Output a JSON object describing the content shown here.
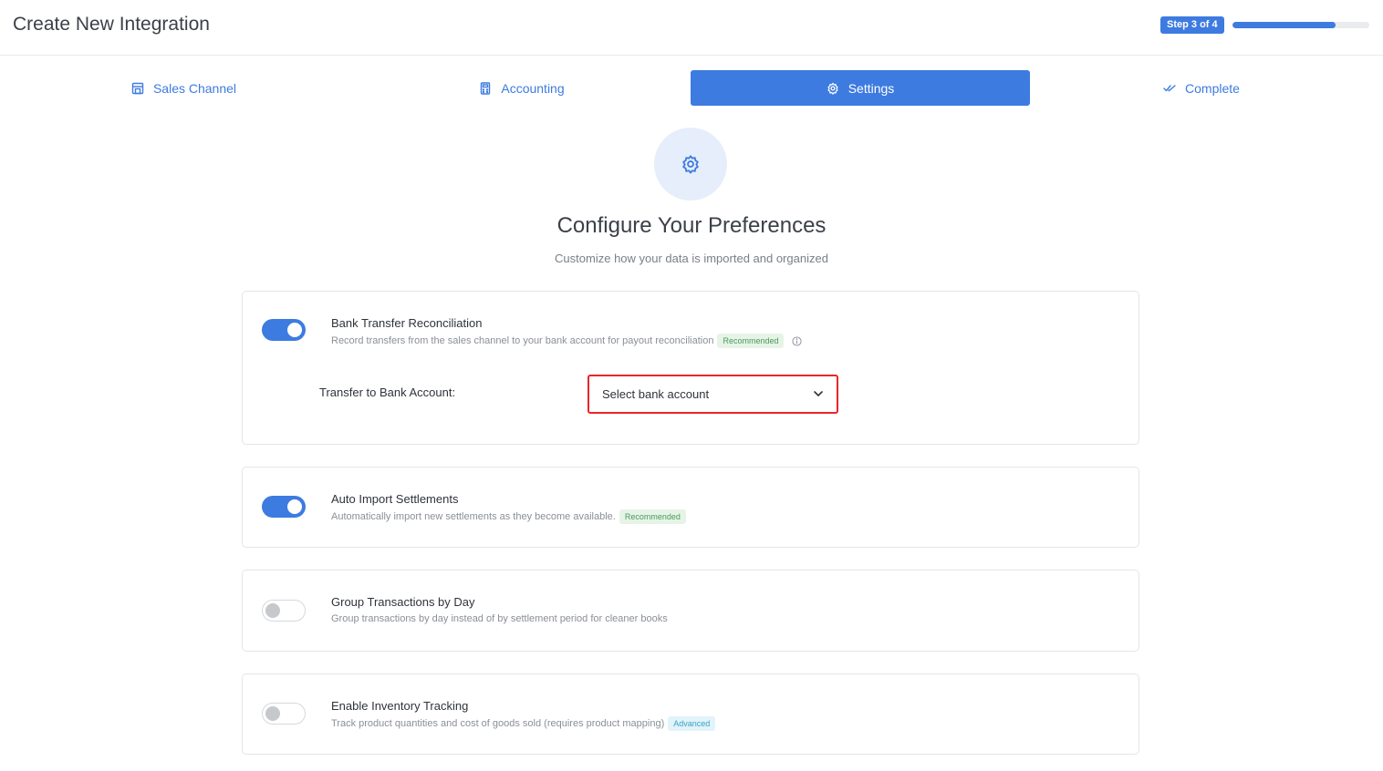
{
  "header": {
    "title": "Create New Integration",
    "step_label": "Step 3 of 4",
    "progress": 0.75
  },
  "tabs": [
    {
      "label": "Sales Channel",
      "icon": "store-icon",
      "active": false
    },
    {
      "label": "Accounting",
      "icon": "calculator-icon",
      "active": false
    },
    {
      "label": "Settings",
      "icon": "gear-icon",
      "active": true
    },
    {
      "label": "Complete",
      "icon": "double-check-icon",
      "active": false
    }
  ],
  "hero": {
    "icon": "gear-icon",
    "title": "Configure Your Preferences",
    "subtitle": "Customize how your data is imported and organized"
  },
  "options": [
    {
      "title": "Bank Transfer Reconciliation",
      "description": "Record transfers from the sales channel to your bank account for payout reconciliation",
      "badge": "Recommended",
      "enabled": true
    },
    {
      "title": "Auto Import Settlements",
      "description": "Automatically import new settlements as they become available.",
      "badge": "Recommended",
      "enabled": true
    },
    {
      "title": "Group Transactions by Day",
      "description": "Group transactions by day instead of by settlement period for cleaner books",
      "enabled": false
    },
    {
      "title": "Enable Inventory Tracking",
      "description": "Track product quantities and cost of goods sold (requires product mapping)",
      "badge": "Advanced",
      "enabled": false
    }
  ],
  "bank_field": {
    "label": "Transfer to Bank Account:",
    "placeholder": "Select bank account"
  },
  "colors": {
    "primary": "#3d7be0",
    "highlight": "#e8262a"
  }
}
